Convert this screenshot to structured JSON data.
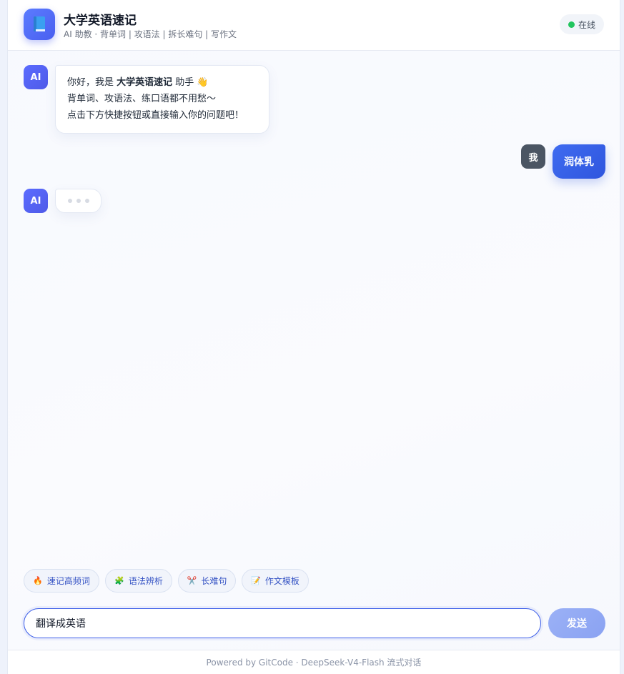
{
  "header": {
    "logo_icon": "book-icon",
    "title": "大学英语速记",
    "subtitle": "AI 助教 · 背单词 | 攻语法 | 拆长难句 | 写作文",
    "status_label": "在线",
    "status_color": "#22c55e"
  },
  "messages": [
    {
      "role": "ai",
      "avatar": "AI",
      "greeting_prefix": "你好，我是 ",
      "greeting_name": "大学英语速记",
      "greeting_suffix": " 助手 👋",
      "line2": "背单词、攻语法、练口语都不用愁～",
      "line3": "点击下方快捷按钮或直接输入你的问题吧！"
    },
    {
      "role": "user",
      "avatar": "我",
      "text": "润体乳"
    },
    {
      "role": "ai",
      "avatar": "AI",
      "state": "typing"
    }
  ],
  "quick_actions": [
    {
      "icon": "🔥",
      "icon_name": "fire-icon",
      "label": "速记高频词"
    },
    {
      "icon": "🧩",
      "icon_name": "puzzle-icon",
      "label": "语法辨析"
    },
    {
      "icon": "✂️",
      "icon_name": "scissors-icon",
      "label": "长难句"
    },
    {
      "icon": "📝",
      "icon_name": "memo-icon",
      "label": "作文模板"
    }
  ],
  "composer": {
    "value": "翻译成英语",
    "send_label": "发送"
  },
  "footer": {
    "text": "Powered by GitCode · DeepSeek-V4-Flash 流式对话"
  },
  "colors": {
    "accent": "#3c5ee8",
    "user_bubble": "#2f56de"
  }
}
